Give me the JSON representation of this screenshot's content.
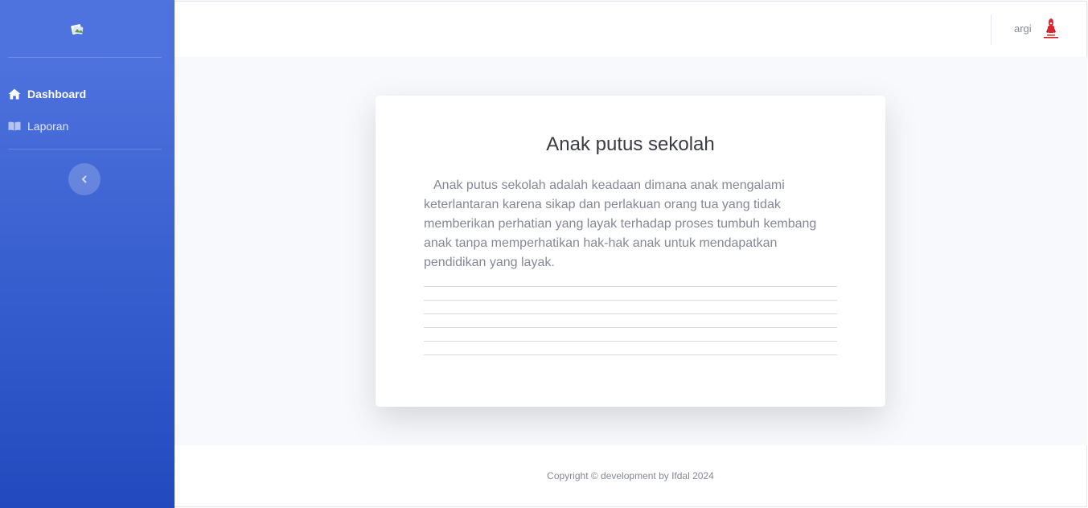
{
  "sidebar": {
    "items": [
      {
        "label": "Dashboard",
        "icon": "home-icon",
        "active": true
      },
      {
        "label": "Laporan",
        "icon": "book-icon",
        "active": false
      }
    ],
    "toggle_icon": "chevron-left-icon"
  },
  "topbar": {
    "user_name": "argi",
    "avatar_icon": "user-avatar-icon"
  },
  "main": {
    "card": {
      "title": "Anak putus sekolah",
      "text": "Anak putus sekolah adalah keadaan dimana anak mengalami keterlantaran karena sikap dan perlakuan orang tua yang tidak memberikan perhatian yang layak terhadap proses tumbuh kembang anak tanpa memperhatikan hak-hak anak untuk mendapatkan pendidikan yang layak."
    }
  },
  "footer": {
    "copyright": "Copyright © development by Ifdal 2024"
  },
  "colors": {
    "sidebar_top": "#4e73df",
    "sidebar_bottom": "#224abe",
    "content_bg": "#f8f9fc",
    "text_muted": "#858796",
    "text_dark": "#3a3b45"
  }
}
